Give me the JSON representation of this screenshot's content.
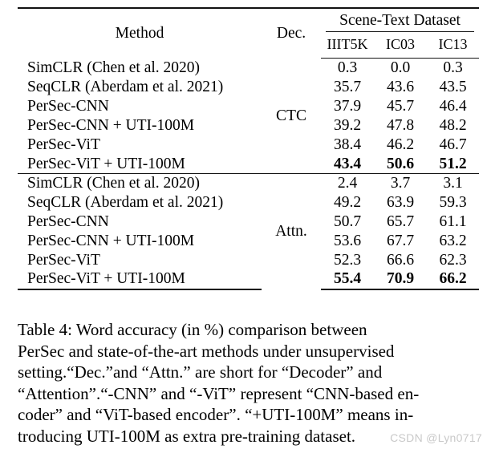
{
  "table": {
    "columns": {
      "method_header": "Method",
      "dec_header": "Dec.",
      "group_header": "Scene-Text Dataset",
      "datasets": [
        "IIIT5K",
        "IC03",
        "IC13"
      ]
    },
    "groups": [
      {
        "decoder": "CTC",
        "rows": [
          {
            "method": "SimCLR (Chen et al. 2020)",
            "values": [
              "0.3",
              "0.0",
              "0.3"
            ],
            "bold": false
          },
          {
            "method": "SeqCLR (Aberdam et al. 2021)",
            "values": [
              "35.7",
              "43.6",
              "43.5"
            ],
            "bold": false
          },
          {
            "method": "PerSec-CNN",
            "values": [
              "37.9",
              "45.7",
              "46.4"
            ],
            "bold": false
          },
          {
            "method": "PerSec-CNN + UTI-100M",
            "values": [
              "39.2",
              "47.8",
              "48.2"
            ],
            "bold": false
          },
          {
            "method": "PerSec-ViT",
            "values": [
              "38.4",
              "46.2",
              "46.7"
            ],
            "bold": false
          },
          {
            "method": "PerSec-ViT + UTI-100M",
            "values": [
              "43.4",
              "50.6",
              "51.2"
            ],
            "bold": true
          }
        ]
      },
      {
        "decoder": "Attn.",
        "rows": [
          {
            "method": "SimCLR (Chen et al. 2020)",
            "values": [
              "2.4",
              "3.7",
              "3.1"
            ],
            "bold": false
          },
          {
            "method": "SeqCLR (Aberdam et al. 2021)",
            "values": [
              "49.2",
              "63.9",
              "59.3"
            ],
            "bold": false
          },
          {
            "method": "PerSec-CNN",
            "values": [
              "50.7",
              "65.7",
              "61.1"
            ],
            "bold": false
          },
          {
            "method": "PerSec-CNN + UTI-100M",
            "values": [
              "53.6",
              "67.7",
              "63.2"
            ],
            "bold": false
          },
          {
            "method": "PerSec-ViT",
            "values": [
              "52.3",
              "66.6",
              "62.3"
            ],
            "bold": false
          },
          {
            "method": "PerSec-ViT + UTI-100M",
            "values": [
              "55.4",
              "70.9",
              "66.2"
            ],
            "bold": true
          }
        ]
      }
    ]
  },
  "caption": {
    "label": "Table 4:",
    "lines": [
      "Table 4: Word accuracy (in %) comparison between",
      "PerSec and state-of-the-art methods under unsupervised",
      "setting.“Dec.”and “Attn.” are short for “Decoder” and",
      "“Attention”.“-CNN” and “-ViT” represent “CNN-based en-",
      "coder” and “ViT-based encoder”. “+UTI-100M” means in-",
      "troducing UTI-100M as extra pre-training dataset."
    ]
  },
  "watermark": {
    "text": "CSDN @Lyn0717",
    "color": "#c9c9c9"
  },
  "colors": {
    "background": "#ffffff",
    "text": "#000000",
    "rule": "#111111"
  }
}
